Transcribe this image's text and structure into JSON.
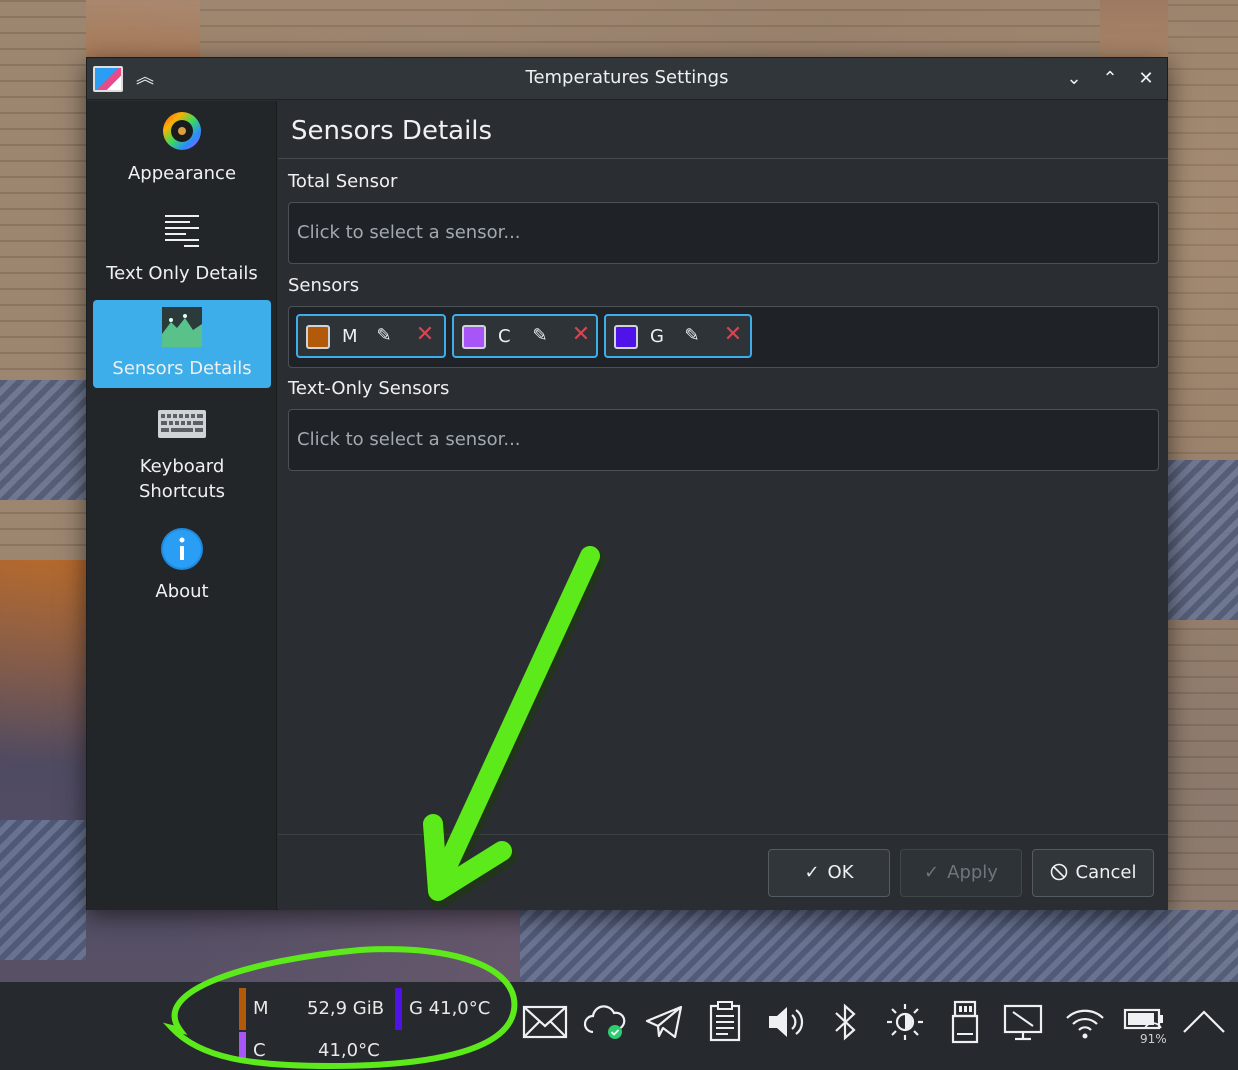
{
  "window": {
    "title": "Temperatures Settings",
    "controls": {
      "keep_above": "︽",
      "minimize": "⌄",
      "maximize": "⌃",
      "close": "✕"
    }
  },
  "sidebar": {
    "items": [
      {
        "label": "Appearance",
        "icon": "color-wheel-icon",
        "active": false
      },
      {
        "label": "Text Only Details",
        "icon": "text-lines-icon",
        "active": false
      },
      {
        "label": "Sensors Details",
        "icon": "chart-landscape-icon",
        "active": true
      },
      {
        "label": "Keyboard Shortcuts",
        "label_line1": "Keyboard",
        "label_line2": "Shortcuts",
        "icon": "keyboard-icon",
        "active": false
      },
      {
        "label": "About",
        "icon": "info-icon",
        "active": false
      }
    ]
  },
  "content": {
    "page_title": "Sensors Details",
    "total_sensor": {
      "label": "Total Sensor",
      "placeholder": "Click to select a sensor..."
    },
    "sensors": {
      "label": "Sensors",
      "chips": [
        {
          "label": "M",
          "color": "#b35a0a"
        },
        {
          "label": "C",
          "color": "#a855f7"
        },
        {
          "label": "G",
          "color": "#4f12e8"
        }
      ]
    },
    "text_only_sensors": {
      "label": "Text-Only Sensors",
      "placeholder": "Click to select a sensor..."
    }
  },
  "buttons": {
    "ok": {
      "label": "OK",
      "icon": "✓"
    },
    "apply": {
      "label": "Apply",
      "icon": "✓"
    },
    "cancel": {
      "label": "Cancel",
      "icon": "⃠"
    }
  },
  "taskbar": {
    "widget": {
      "m_label": "M",
      "m_value": "52,9 GiB",
      "g_label": "G 41,0°C",
      "c_label": "C",
      "c_value": "41,0°C"
    },
    "battery_percent": "91%"
  },
  "colors": {
    "accent": "#3daee9",
    "annotation": "#5dea1a",
    "remove": "#da4453"
  }
}
